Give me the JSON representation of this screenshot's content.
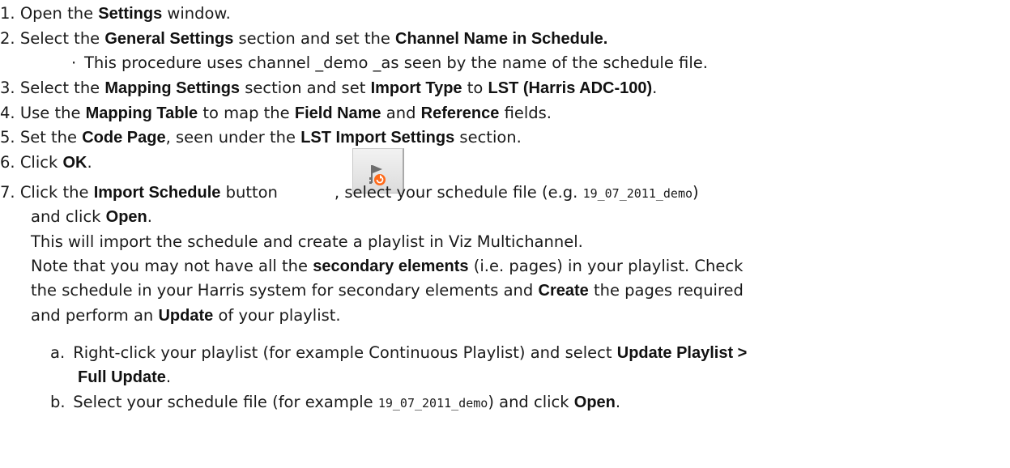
{
  "steps": [
    {
      "n": "1.",
      "t1": "Open the ",
      "b1": "Settings",
      "t2": " window."
    },
    {
      "n": "2.",
      "t1": "Select the ",
      "b1": "General Settings",
      "t2": " section and set the ",
      "b2": "Channel Name in Schedule."
    },
    {
      "bullet": "·",
      "t1": "This procedure uses channel _demo _as seen by the name of the schedule file."
    },
    {
      "n": "3.",
      "t1": "Select the ",
      "b1": "Mapping Settings",
      "t2": " section and set ",
      "b2": "Import Type",
      "t3": " to ",
      "b3": "LST (Harris ADC-100)",
      "t4": "."
    },
    {
      "n": "4.",
      "t1": "Use the ",
      "b1": "Mapping Table",
      "t2": " to map the ",
      "b2": "Field Name",
      "t3": " and ",
      "b3": "Reference",
      "t4": " fields."
    },
    {
      "n": "5.",
      "t1": "Set the ",
      "b1": "Code Page",
      "t2": ", seen under the ",
      "b2": "LST Import Settings",
      "t3": " section."
    },
    {
      "n": "6.",
      "t1": "Click ",
      "b1": "OK",
      "t2": "."
    },
    {
      "n": "7.",
      "t1": "Click the ",
      "b1": "Import Schedule",
      "t2": " button",
      "t3": ", select your schedule file (e.g. ",
      "c1": "19_07_2011_demo",
      "t4": ")"
    },
    {
      "t1": "and click ",
      "b1": "Open",
      "t2": "."
    },
    {
      "t1": "This will import the schedule and create a playlist in Viz Multichannel."
    },
    {
      "t1": "Note that you may not have all the ",
      "b1": "secondary elements",
      "t2": " (i.e. pages) in your playlist. Check"
    },
    {
      "t1": "the schedule in your Harris system for secondary elements and ",
      "b1": "Create",
      "t2": " the pages required"
    },
    {
      "t1": "and perform an ",
      "b1": "Update",
      "t2": " of your playlist."
    },
    {
      "n": "a.",
      "t1": "Right-click your playlist (for example Continuous Playlist) and select ",
      "b1": "Update Playlist >"
    },
    {
      "b1": "Full Update",
      "t1": "."
    },
    {
      "n": "b.",
      "t1": "Select your schedule file (for example ",
      "c1": "19_07_2011_demo",
      "t2": ") and click ",
      "b1": "Open",
      "t3": "."
    }
  ],
  "icon": {
    "name": "import-schedule-icon",
    "flag_color": "#6e6e6e",
    "accent": "#ff6a1a"
  }
}
